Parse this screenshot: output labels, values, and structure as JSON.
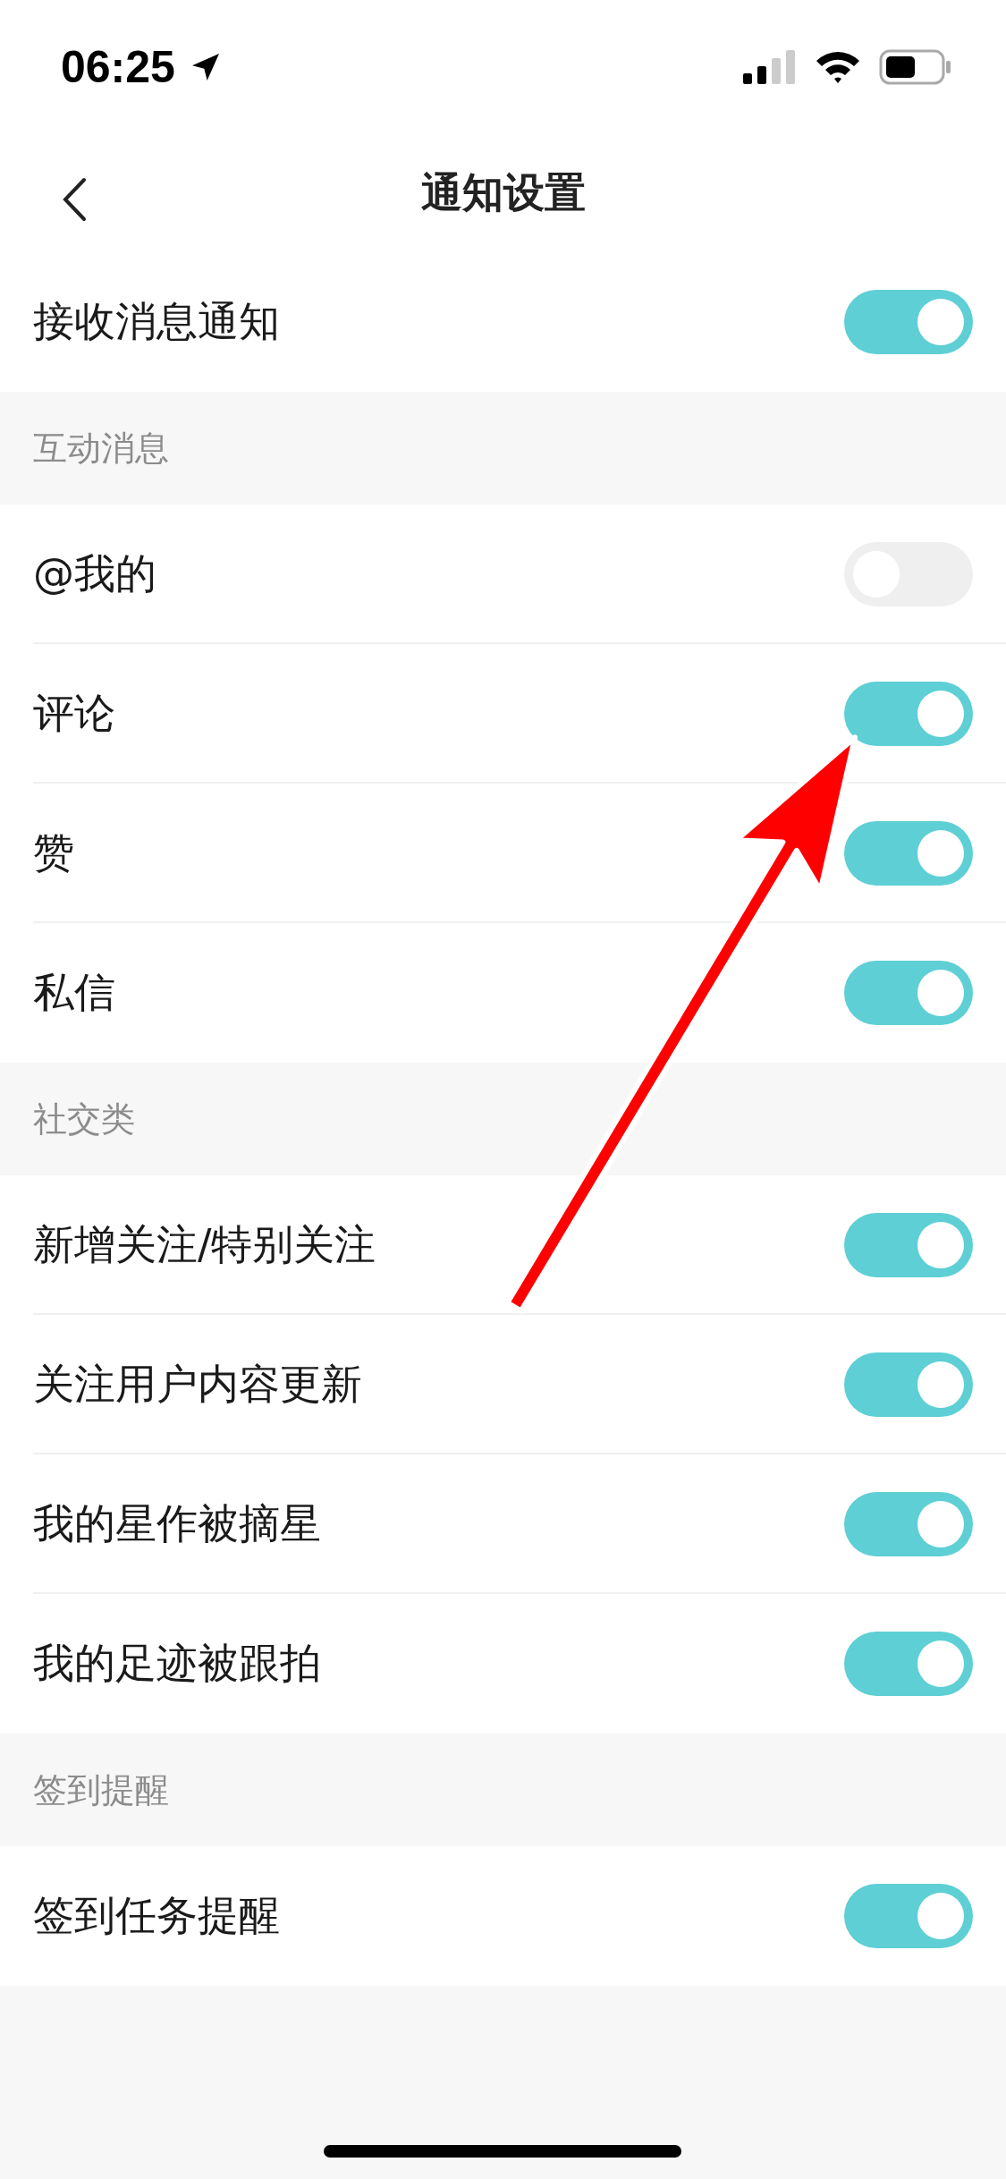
{
  "status_bar": {
    "time": "06:25"
  },
  "nav": {
    "title": "通知设置"
  },
  "master": {
    "label": "接收消息通知",
    "on": true
  },
  "groups": [
    {
      "title": "互动消息",
      "items": [
        {
          "label": "@我的",
          "on": false
        },
        {
          "label": "评论",
          "on": true
        },
        {
          "label": "赞",
          "on": true
        },
        {
          "label": "私信",
          "on": true
        }
      ]
    },
    {
      "title": "社交类",
      "items": [
        {
          "label": "新增关注/特别关注",
          "on": true
        },
        {
          "label": "关注用户内容更新",
          "on": true
        },
        {
          "label": "我的星作被摘星",
          "on": true
        },
        {
          "label": "我的足迹被跟拍",
          "on": true
        }
      ]
    },
    {
      "title": "签到提醒",
      "items": [
        {
          "label": "签到任务提醒",
          "on": true
        }
      ]
    }
  ]
}
